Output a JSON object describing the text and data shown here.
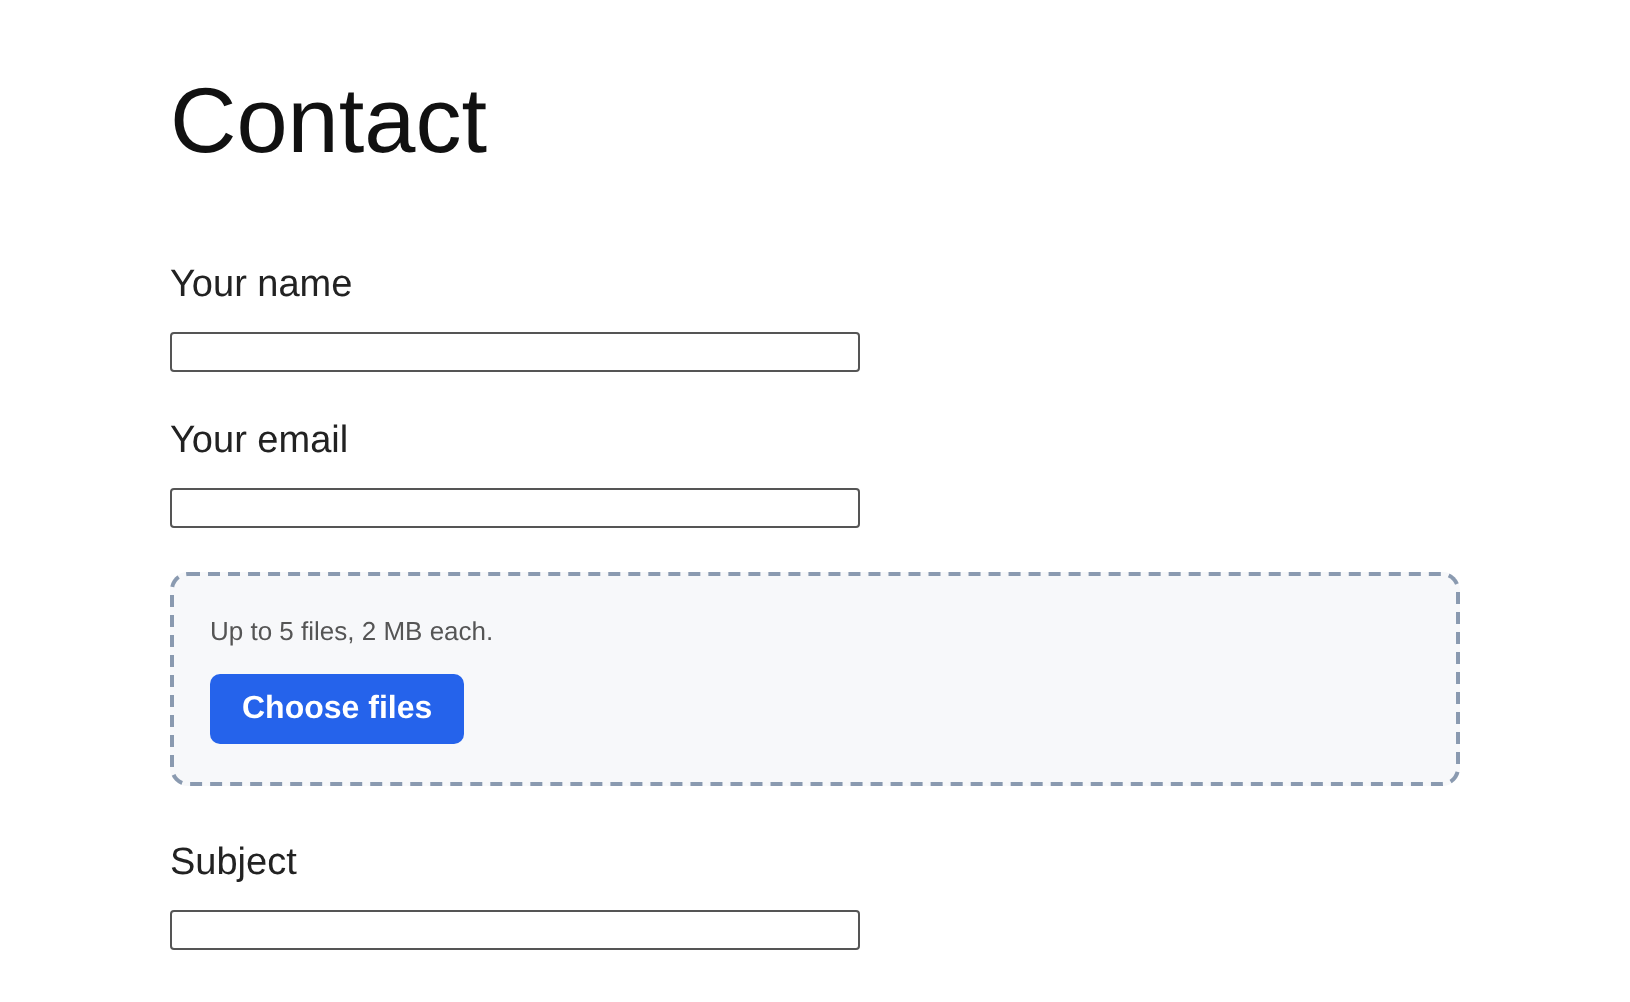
{
  "title": "Contact",
  "fields": [
    {
      "kind": "text",
      "label": "Your name"
    },
    {
      "kind": "text",
      "label": "Your email"
    },
    {
      "kind": "upload",
      "hint": "Up to 5 files, 2 MB each.",
      "button": "Choose files"
    },
    {
      "kind": "text",
      "label": "Subject"
    }
  ]
}
